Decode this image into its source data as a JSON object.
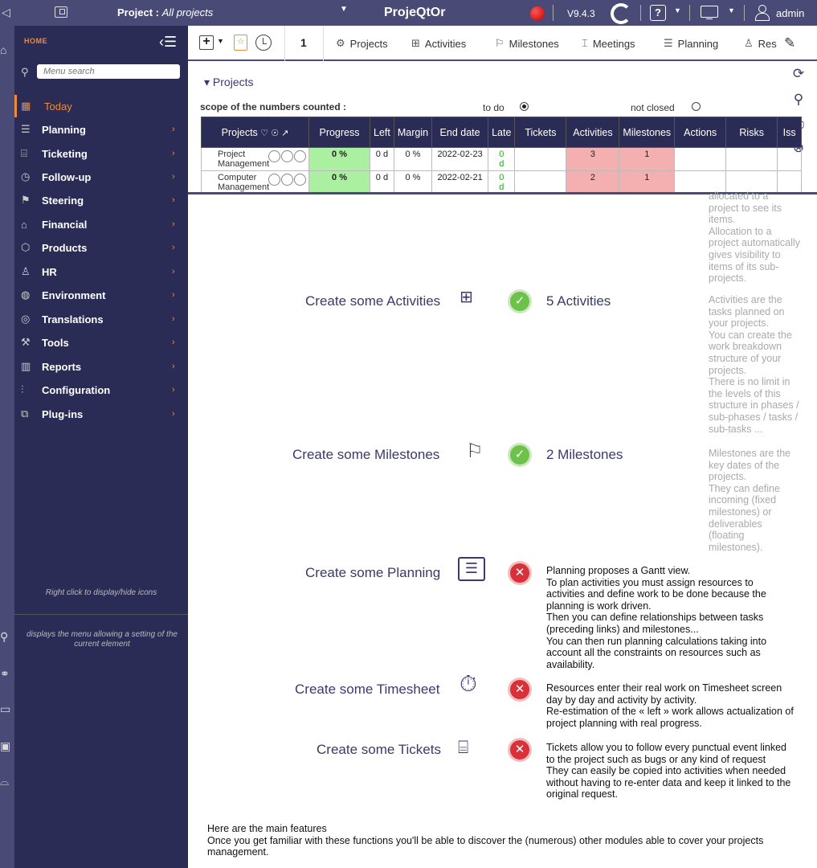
{
  "topbar": {
    "project_prefix": "Project :",
    "project_value": "All projects",
    "app_title": "ProjeQtOr",
    "version": "V9.4.3",
    "help_label": "?",
    "user_name": "admin"
  },
  "sidebar": {
    "home_label": "HOME",
    "search_placeholder": "Menu search",
    "items": [
      {
        "label": "Today",
        "icon": "calendar-icon"
      },
      {
        "label": "Planning",
        "icon": "gantt-icon"
      },
      {
        "label": "Ticketing",
        "icon": "ticket-icon"
      },
      {
        "label": "Follow-up",
        "icon": "followup-icon"
      },
      {
        "label": "Steering",
        "icon": "steering-icon"
      },
      {
        "label": "Financial",
        "icon": "bank-icon"
      },
      {
        "label": "Products",
        "icon": "box-icon"
      },
      {
        "label": "HR",
        "icon": "person-icon"
      },
      {
        "label": "Environment",
        "icon": "globe-icon"
      },
      {
        "label": "Translations",
        "icon": "translate-icon"
      },
      {
        "label": "Tools",
        "icon": "tools-icon"
      },
      {
        "label": "Reports",
        "icon": "reports-icon"
      },
      {
        "label": "Configuration",
        "icon": "config-icon"
      },
      {
        "label": "Plug-ins",
        "icon": "puzzle-icon"
      }
    ],
    "hint_icons": "Right click to display/hide icons",
    "hint_menu": "displays the menu allowing a setting of the current element"
  },
  "toolbar": {
    "count": "1",
    "buttons": [
      "Projects",
      "Activities",
      "Milestones",
      "Meetings",
      "Planning",
      "Res"
    ]
  },
  "panel": {
    "title": "Projects",
    "scope_label": "scope of the numbers counted :",
    "todo_label": "to do",
    "notclosed_label": "not closed",
    "headers": [
      "Projects",
      "Progress",
      "Left",
      "Margin",
      "End date",
      "Late",
      "Tickets",
      "Activities",
      "Milestones",
      "Actions",
      "Risks",
      "Iss"
    ],
    "rows": [
      {
        "name1": "Project",
        "name2": "Management",
        "progress": "0 %",
        "left": "0 d",
        "margin": "0 %",
        "end": "2022-02-23",
        "late1": "0",
        "late2": "d",
        "tickets": "",
        "activities": "3",
        "milestones": "1"
      },
      {
        "name1": "Computer",
        "name2": "Management",
        "progress": "0 %",
        "left": "0 d",
        "margin": "0 %",
        "end": "2022-02-21",
        "late1": "0",
        "late2": "d",
        "tickets": "",
        "activities": "2",
        "milestones": "1"
      }
    ]
  },
  "steps": [
    {
      "label": "Create some Activities",
      "count": "5 Activities"
    },
    {
      "label": "Create some Milestones",
      "count": "2 Milestones"
    },
    {
      "label": "Create some Planning",
      "desc": [
        "Planning proposes a Gantt view.",
        "To plan activities you must assign resources to",
        "activities and define work to be done because the",
        "planning is work driven.",
        "Then you can define relationships between tasks",
        "(preceding links) and milestones...",
        "You can then run planning calculations taking into",
        "account all the constraints on resources such as",
        "availability."
      ]
    },
    {
      "label": "Create some Timesheet",
      "desc": [
        "Resources enter their real work on Timesheet screen",
        "day by day and activity by activity.",
        "Re-estimation of the « left » work allows actualization of",
        "project planning with real progress."
      ]
    },
    {
      "label": "Create some Tickets",
      "desc": [
        "Tickets allow you to follow every punctual event linked",
        "to the project such as bugs or any kind of request",
        "They can easily be copied into activities when needed",
        "without having to re-enter data and keep it linked to the",
        "original request."
      ]
    }
  ],
  "side_notes": {
    "projects": [
      "allocated to a",
      "project to see its",
      "items.",
      "Allocation to a",
      "project automatically",
      "gives visibility to",
      "items of its sub-",
      "projects."
    ],
    "activities": [
      "Activities are the",
      "tasks planned on",
      "your projects.",
      "You can create the",
      "work breakdown",
      "structure of your",
      "projects.",
      "There is no limit in",
      "the levels of this",
      "structure in phases /",
      "sub-phases / tasks /",
      "sub-tasks ..."
    ],
    "milestones": [
      "Milestones are the",
      "key dates of the",
      "projects.",
      "They can define",
      "incoming (fixed",
      "milestones) or",
      "deliverables",
      "(floating",
      "milestones)."
    ]
  },
  "footer": [
    "Here are the main features",
    "Once you get familiar with these functions you'll be able to discover the (numerous) other modules able to cover your projects",
    "management."
  ]
}
